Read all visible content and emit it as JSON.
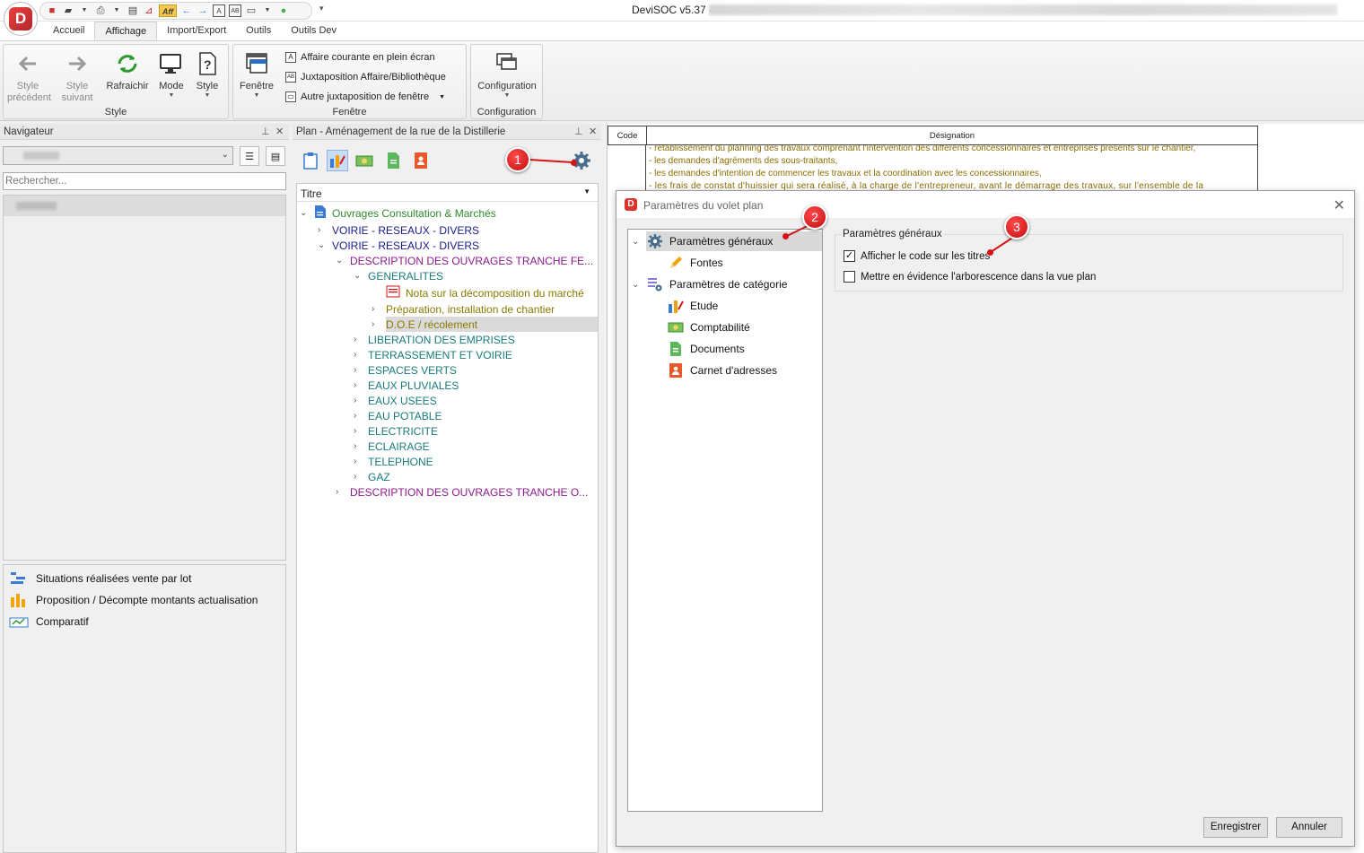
{
  "window": {
    "title": "DeviSOC v5.37 -"
  },
  "tabs": [
    "Accueil",
    "Affichage",
    "Import/Export",
    "Outils",
    "Outils Dev"
  ],
  "active_tab": "Affichage",
  "ribbon": {
    "style_group": {
      "label": "Style",
      "prev": "Style précédent",
      "next": "Style suivant",
      "refresh": "Rafraichir",
      "mode": "Mode",
      "style": "Style"
    },
    "window_group": {
      "label": "Fenêtre",
      "window": "Fenêtre",
      "fullscreen": "Affaire courante en plein écran",
      "juxta": "Juxtaposition Affaire/Bibliothèque",
      "other": "Autre juxtaposition de fenêtre"
    },
    "config_group": {
      "label": "Configuration",
      "config": "Configuration"
    }
  },
  "navigator": {
    "title": "Navigateur",
    "search_placeholder": "Rechercher...",
    "bottom_items": [
      "Situations réalisées vente par lot",
      "Proposition / Décompte montants actualisation",
      "Comparatif"
    ]
  },
  "plan": {
    "title": "Plan - Aménagement de la rue de la Distillerie",
    "column": "Titre",
    "tree": [
      {
        "t": "Ouvrages Consultation & Marchés"
      },
      {
        "t": "VOIRIE - RESEAUX - DIVERS"
      },
      {
        "t": "VOIRIE - RESEAUX - DIVERS"
      },
      {
        "t": "DESCRIPTION DES OUVRAGES TRANCHE FE..."
      },
      {
        "t": "GENERALITES"
      },
      {
        "t": "Nota sur la décomposition du marché"
      },
      {
        "t": "Préparation, installation de chantier"
      },
      {
        "t": "D.O.E / récolement"
      },
      {
        "t": "LIBERATION DES EMPRISES"
      },
      {
        "t": "TERRASSEMENT ET VOIRIE"
      },
      {
        "t": "ESPACES VERTS"
      },
      {
        "t": "EAUX PLUVIALES"
      },
      {
        "t": "EAUX USEES"
      },
      {
        "t": "EAU POTABLE"
      },
      {
        "t": "ELECTRICITE"
      },
      {
        "t": "ECLAIRAGE"
      },
      {
        "t": "TELEPHONE"
      },
      {
        "t": "GAZ"
      },
      {
        "t": "DESCRIPTION DES OUVRAGES TRANCHE O..."
      }
    ]
  },
  "grid": {
    "col_code": "Code",
    "col_designation": "Désignation",
    "lines": [
      "- rétablissement du planning des travaux comprenant l'intervention des différents concessionnaires et entreprises présents sur le chantier,",
      "- les demandes d'agréments des sous-traitants,",
      "- les demandes d'intention de commencer les travaux et la coordination avec les concessionnaires,",
      "- les frais de constat d'huissier qui sera réalisé, à la charge de l'entrepreneur, avant le démarrage des travaux, sur l'ensemble de la"
    ]
  },
  "dialog": {
    "title": "Paramètres du volet plan",
    "tree": [
      "Paramètres généraux",
      "Fontes",
      "Paramètres de catégorie",
      "Etude",
      "Comptabilité",
      "Documents",
      "Carnet d'adresses"
    ],
    "group_title": "Paramètres généraux",
    "options": [
      {
        "label": "Afficher le code sur les titres",
        "checked": true
      },
      {
        "label": "Mettre en évidence l'arborescence dans la vue plan",
        "checked": false
      }
    ],
    "save": "Enregistrer",
    "cancel": "Annuler"
  },
  "callouts": [
    "1",
    "2",
    "3"
  ],
  "colors": {
    "green": "#2e8b2e",
    "navy": "#1a1a8c",
    "purple": "#8b1a8b",
    "teal": "#1a7a7a",
    "olive": "#8a7a00",
    "red": "#d31515"
  }
}
